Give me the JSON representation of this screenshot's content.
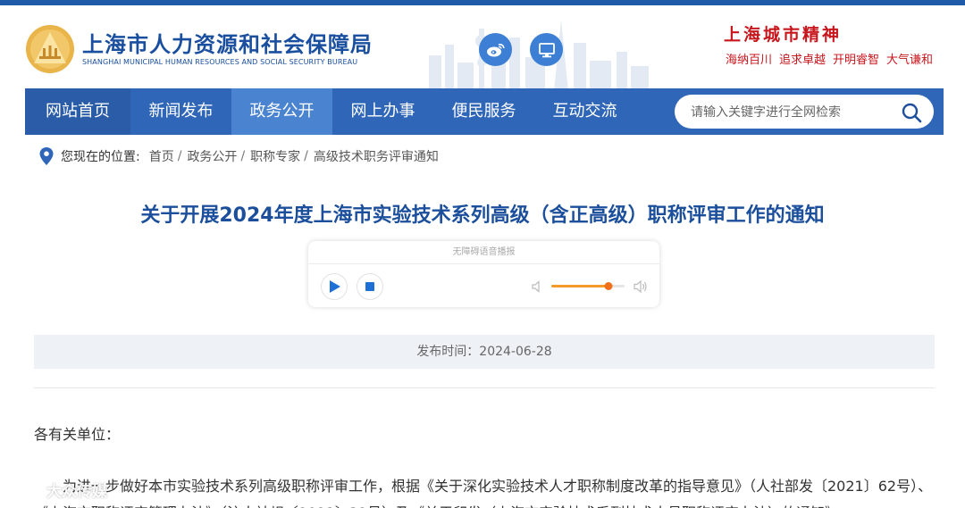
{
  "header": {
    "title_cn": "上海市人力资源和社会保障局",
    "title_en": "SHANGHAI MUNICIPAL HUMAN RESOURCES AND SOCIAL SECURITY BUREAU",
    "city_spirit_title": "上海城市精神",
    "city_spirit_phrases": [
      "海纳百川",
      "追求卓越",
      "开明睿智",
      "大气谦和"
    ],
    "weibo_icon": "weibo-icon",
    "desktop_icon": "desktop-icon"
  },
  "nav": {
    "items": [
      "网站首页",
      "新闻发布",
      "政务公开",
      "网上办事",
      "便民服务",
      "互动交流"
    ],
    "active": "政务公开"
  },
  "search": {
    "placeholder": "请输入关键字进行全网检索",
    "value": ""
  },
  "breadcrumb": {
    "label": "您现在的位置:",
    "items": [
      "首页",
      "政务公开",
      "职称专家",
      "高级技术职务评审通知"
    ]
  },
  "article": {
    "title": "关于开展2024年度上海市实验技术系列高级（含正高级）职称评审工作的通知",
    "publish": "发布时间：2024-06-28",
    "salutation": "各有关单位：",
    "paragraph": "为进一步做好本市实验技术系列高级职称评审工作，根据《关于深化实验技术人才职称制度改革的指导意见》（人社部发〔2021〕62号）、《上海市职称评定管理办法》（沪人社规〔2021〕32号）及《关于印发〈上海市实验技术系列技术人员职称评定办法〉的通知》"
  },
  "player": {
    "heading": "无障碍语音播报",
    "volume": 0.78
  },
  "watermark": {
    "text": "大众传媒"
  },
  "colors": {
    "brand_blue": "#2f66b8",
    "title_blue": "#1b4f9c",
    "active_nav": "#4a83d0",
    "spirit_red": "#c8161d",
    "volume_orange": "#f26f1a"
  }
}
